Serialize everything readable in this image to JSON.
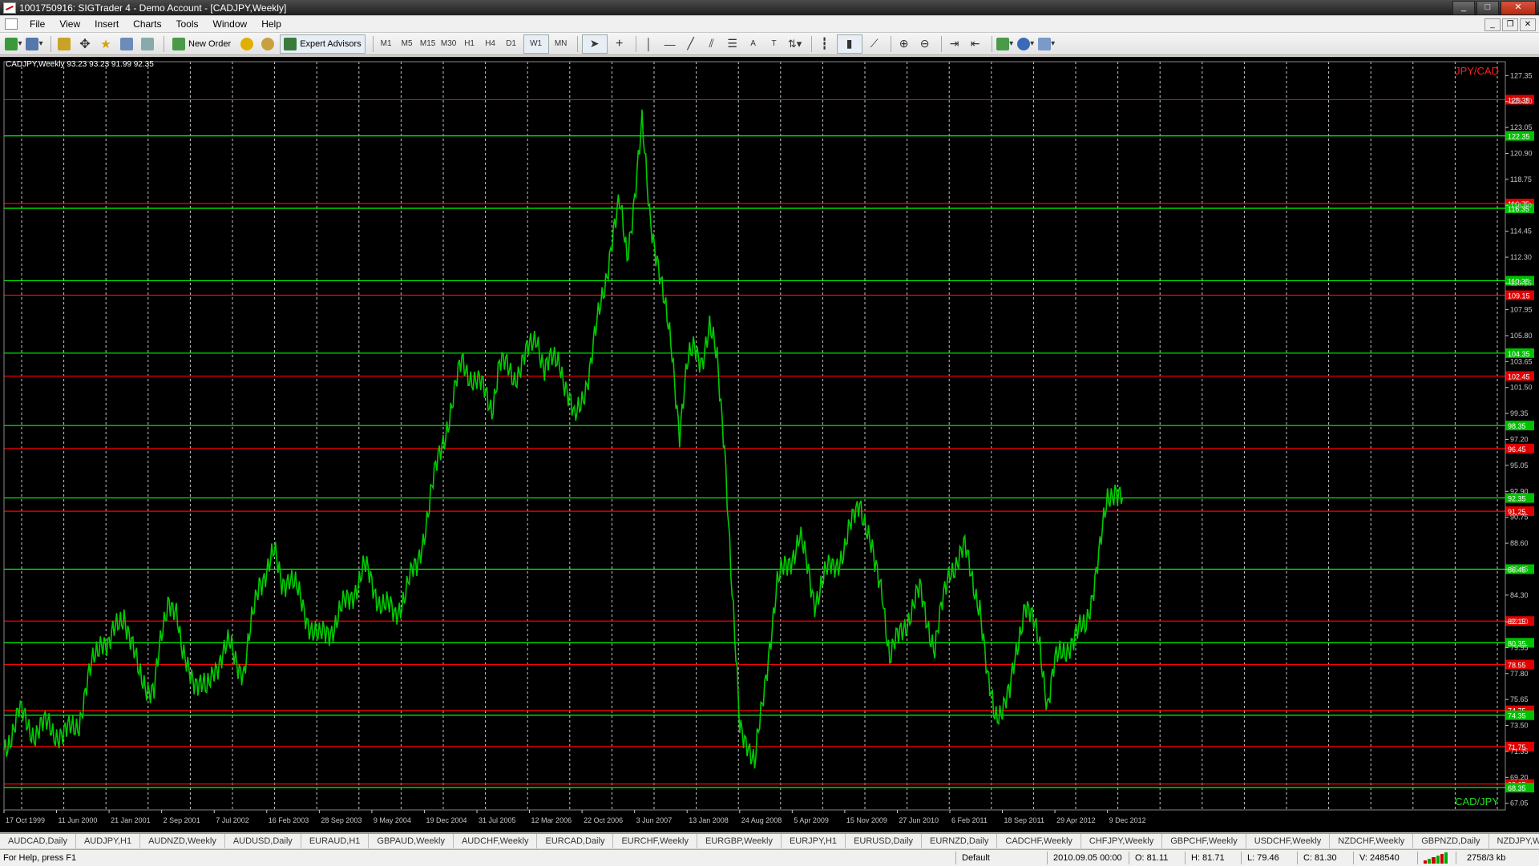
{
  "window": {
    "title": "1001750916: SIGTrader 4 - Demo Account - [CADJPY,Weekly]",
    "minimize": "_",
    "maximize": "□",
    "close": "✕"
  },
  "menu": [
    "File",
    "View",
    "Insert",
    "Charts",
    "Tools",
    "Window",
    "Help"
  ],
  "toolbar": {
    "new_order": "New Order",
    "expert_advisors": "Expert Advisors",
    "timeframes": [
      "M1",
      "M5",
      "M15",
      "M30",
      "H1",
      "H4",
      "D1",
      "W1",
      "MN"
    ],
    "active_timeframe": "W1",
    "text_tool": "A",
    "label_tool": "T"
  },
  "chart": {
    "info": "CADJPY,Weekly  93.23 93.23 91.99 92.35",
    "label_top": "JPY/CAD",
    "label_bottom": "CAD/JPY",
    "colors": {
      "background": "#000000",
      "price_line": "#00cc00",
      "support": "#00ff00",
      "resistance": "#ff0000",
      "grid": "#c8c8c8",
      "axis_text": "#c8c8c8"
    }
  },
  "chart_data": {
    "type": "line",
    "ylim": [
      66.5,
      128.5
    ],
    "xlim": [
      0,
      1000
    ],
    "y_ticks": [
      127.35,
      125.2,
      123.05,
      120.9,
      118.75,
      116.6,
      114.45,
      112.3,
      110.15,
      107.95,
      105.8,
      103.65,
      101.5,
      99.35,
      97.2,
      95.05,
      92.9,
      90.75,
      88.6,
      86.45,
      84.3,
      82.1,
      79.95,
      77.8,
      75.65,
      73.5,
      71.35,
      69.2,
      67.05
    ],
    "x_ticks": [
      {
        "x": 0,
        "label": "17 Oct 1999"
      },
      {
        "x": 35,
        "label": "11 Jun 2000"
      },
      {
        "x": 70,
        "label": "21 Jan 2001"
      },
      {
        "x": 105,
        "label": "2 Sep 2001"
      },
      {
        "x": 140,
        "label": "7 Jul 2002"
      },
      {
        "x": 175,
        "label": "16 Feb 2003"
      },
      {
        "x": 210,
        "label": "28 Sep 2003"
      },
      {
        "x": 245,
        "label": "9 May 2004"
      },
      {
        "x": 280,
        "label": "19 Dec 2004"
      },
      {
        "x": 315,
        "label": "31 Jul 2005"
      },
      {
        "x": 350,
        "label": "12 Mar 2006"
      },
      {
        "x": 385,
        "label": "22 Oct 2006"
      },
      {
        "x": 420,
        "label": "3 Jun 2007"
      },
      {
        "x": 455,
        "label": "13 Jan 2008"
      },
      {
        "x": 490,
        "label": "24 Aug 2008"
      },
      {
        "x": 525,
        "label": "5 Apr 2009"
      },
      {
        "x": 560,
        "label": "15 Nov 2009"
      },
      {
        "x": 595,
        "label": "27 Jun 2010"
      },
      {
        "x": 630,
        "label": "6 Feb 2011"
      },
      {
        "x": 665,
        "label": "18 Sep 2011"
      },
      {
        "x": 700,
        "label": "29 Apr 2012"
      },
      {
        "x": 735,
        "label": "9 Dec 2012"
      }
    ],
    "levels": [
      {
        "value": 125.35,
        "color": "red"
      },
      {
        "value": 122.35,
        "color": "green"
      },
      {
        "value": 116.75,
        "color": "red"
      },
      {
        "value": 116.35,
        "color": "green"
      },
      {
        "value": 110.35,
        "color": "green"
      },
      {
        "value": 109.15,
        "color": "red"
      },
      {
        "value": 104.35,
        "color": "green"
      },
      {
        "value": 102.45,
        "color": "red"
      },
      {
        "value": 98.35,
        "color": "green"
      },
      {
        "value": 96.45,
        "color": "red"
      },
      {
        "value": 92.35,
        "color": "green"
      },
      {
        "value": 91.25,
        "color": "red"
      },
      {
        "value": 86.45,
        "color": "green"
      },
      {
        "value": 82.15,
        "color": "red"
      },
      {
        "value": 80.35,
        "color": "green"
      },
      {
        "value": 78.55,
        "color": "red"
      },
      {
        "value": 74.75,
        "color": "red"
      },
      {
        "value": 74.35,
        "color": "green"
      },
      {
        "value": 71.75,
        "color": "red"
      },
      {
        "value": 68.65,
        "color": "red"
      },
      {
        "value": 68.35,
        "color": "green"
      }
    ],
    "series": [
      {
        "x": [
          0,
          10,
          20,
          30,
          40,
          50,
          60,
          65,
          70,
          80,
          90,
          100,
          110,
          118,
          125,
          135,
          140,
          150,
          160,
          170,
          180,
          185,
          190,
          200,
          210,
          220,
          230,
          240,
          250,
          260,
          270,
          275,
          285,
          295,
          305,
          315,
          320,
          325,
          330,
          340,
          350,
          355,
          360,
          370,
          380,
          390,
          400,
          405,
          410,
          415,
          420,
          425,
          430,
          435,
          440,
          445,
          450,
          455,
          460,
          465,
          470,
          475,
          480,
          485,
          490,
          495,
          500,
          505,
          510,
          515,
          520,
          530,
          540,
          550,
          560,
          570,
          580,
          585,
          590,
          600,
          610,
          620,
          630,
          640,
          650,
          655,
          660,
          670,
          680,
          690,
          695,
          700,
          710,
          720,
          730,
          735,
          740,
          745
        ],
        "values": [
          71.5,
          74.5,
          73.0,
          73.5,
          72.5,
          74.0,
          79.0,
          81.0,
          80.0,
          83.0,
          77.5,
          76.5,
          84.5,
          80.5,
          78.0,
          76.0,
          78.5,
          80.0,
          78.0,
          85.5,
          87.5,
          85.5,
          86.0,
          83.0,
          80.5,
          82.0,
          84.0,
          86.5,
          84.0,
          82.5,
          85.5,
          86.5,
          93.0,
          98.5,
          103.5,
          102.0,
          101.0,
          100.0,
          103.5,
          102.5,
          104.5,
          106.0,
          103.0,
          104.0,
          98.5,
          103.0,
          110.0,
          114.0,
          116.5,
          112.5,
          117.5,
          123.0,
          116.0,
          112.5,
          108.0,
          104.5,
          98.0,
          103.0,
          105.0,
          104.0,
          106.0,
          104.0,
          97.0,
          84.0,
          73.5,
          72.5,
          70.0,
          75.0,
          80.5,
          85.0,
          86.5,
          89.0,
          84.0,
          86.5,
          88.0,
          92.5,
          86.5,
          85.0,
          79.0,
          82.0,
          84.5,
          80.0,
          86.5,
          88.0,
          83.5,
          77.0,
          74.5,
          76.0,
          84.0,
          80.0,
          75.5,
          78.5,
          80.5,
          81.5,
          88.0,
          92.0,
          93.5,
          92.35
        ]
      }
    ]
  },
  "price_labels": [
    "125.35",
    "122.35",
    "116.75",
    "116.35",
    "110.35",
    "109.15",
    "104.35",
    "102.45",
    "98.35",
    "96.45",
    "92.35",
    "91.25",
    "86.45",
    "82.15",
    "80.35",
    "78.55",
    "74.75",
    "74.35",
    "71.75",
    "68.65",
    "68.35"
  ],
  "symbol_tabs": [
    "AUDCAD,Daily",
    "AUDJPY,H1",
    "AUDNZD,Weekly",
    "AUDUSD,Daily",
    "EURAUD,H1",
    "GBPAUD,Weekly",
    "AUDCHF,Weekly",
    "EURCAD,Daily",
    "EURCHF,Weekly",
    "EURGBP,Weekly",
    "EURJPY,H1",
    "EURUSD,Daily",
    "EURNZD,Daily",
    "CADCHF,Weekly",
    "CHFJPY,Weekly",
    "GBPCHF,Weekly",
    "USDCHF,Weekly",
    "NZDCHF,Weekly",
    "GBPNZD,Daily",
    "NZDJPY,Weekly"
  ],
  "status": {
    "help": "For Help, press F1",
    "profile": "Default",
    "datetime": "2010.09.05 00:00",
    "open": "O: 81.11",
    "high": "H: 81.71",
    "low": "L: 79.46",
    "close": "C: 81.30",
    "volume": "V: 248540",
    "traffic": "2758/3 kb"
  }
}
